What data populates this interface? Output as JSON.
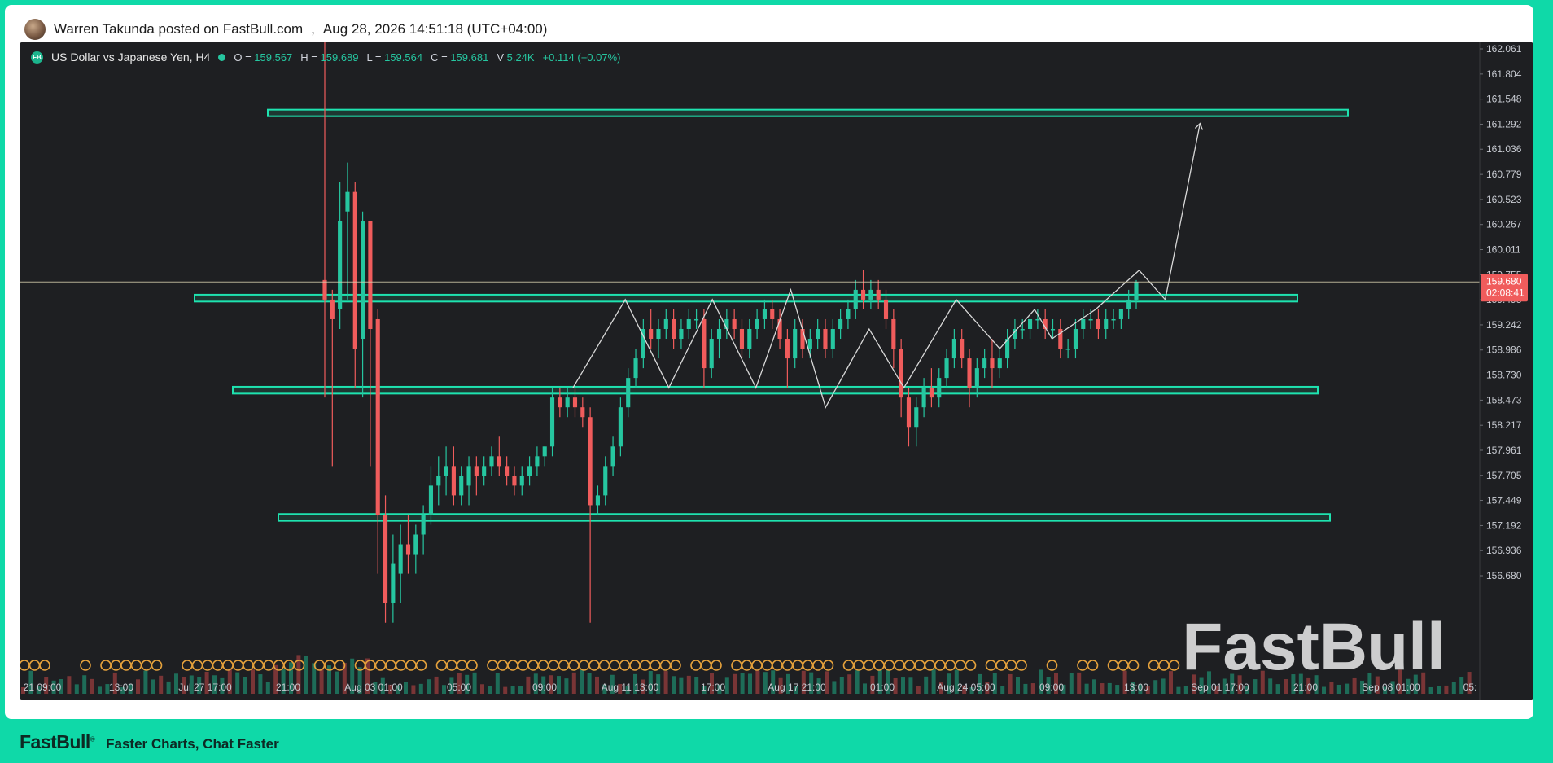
{
  "post": {
    "author_line": "Warren Takunda posted on FastBull.com",
    "separator": ",",
    "timestamp": "Aug 28, 2026 14:51:18 (UTC+04:00)"
  },
  "legend": {
    "badge": "FB",
    "pair": "US Dollar vs Japanese Yen, H4",
    "o_label": "O =",
    "o_value": "159.567",
    "h_label": "H =",
    "h_value": "159.689",
    "l_label": "L =",
    "l_value": "159.564",
    "c_label": "C =",
    "c_value": "159.681",
    "v_label": "V",
    "v_value": "5.24K",
    "change": "+0.114 (+0.07%)"
  },
  "watermark": "FastBull",
  "footer": {
    "brand": "FastBull",
    "tagline": "Faster Charts, Chat Faster"
  },
  "colors": {
    "background": "#1e1f22",
    "up": "#26c6a0",
    "down": "#f05c5c",
    "zone": "#1ee3b0",
    "brand_green": "#0fd9a8"
  },
  "chart_data": {
    "type": "candlestick",
    "title": "US Dollar vs Japanese Yen, H4",
    "y_axis": {
      "ticks": [
        "162.061",
        "161.804",
        "161.548",
        "161.292",
        "161.036",
        "160.779",
        "160.523",
        "160.267",
        "160.011",
        "159.755",
        "159.498",
        "159.242",
        "158.986",
        "158.730",
        "158.473",
        "158.217",
        "157.961",
        "157.705",
        "157.449",
        "157.192",
        "156.936",
        "156.680"
      ],
      "range": [
        156.5,
        162.1
      ]
    },
    "x_axis": {
      "ticks": [
        "21 09:00",
        "13:00",
        "Jul 27 17:00",
        "21:00",
        "Aug 03 01:00",
        "05:00",
        "09:00",
        "Aug 11 13:00",
        "17:00",
        "Aug 17 21:00",
        "01:00",
        "Aug 24 05:00",
        "09:00",
        "13:00",
        "Sep 01 17:00",
        "21:00",
        "Sep 08 01:00",
        "05:"
      ]
    },
    "current_price": {
      "value": "159.680",
      "countdown": "02:08:41"
    },
    "zones": [
      {
        "label": "resistance-top",
        "price_low": 161.38,
        "price_high": 161.44
      },
      {
        "label": "resistance-mid",
        "price_low": 159.48,
        "price_high": 159.55
      },
      {
        "label": "support-mid",
        "price_low": 158.54,
        "price_high": 158.61
      },
      {
        "label": "support-low",
        "price_low": 157.24,
        "price_high": 157.31
      }
    ],
    "ohlc": [
      [
        159.7,
        163.0,
        158.5,
        159.5
      ],
      [
        159.5,
        159.6,
        157.8,
        159.3
      ],
      [
        159.4,
        160.7,
        159.2,
        160.3
      ],
      [
        160.4,
        160.9,
        159.5,
        160.6
      ],
      [
        160.6,
        160.7,
        158.6,
        159.0
      ],
      [
        159.1,
        160.4,
        158.5,
        160.3
      ],
      [
        160.3,
        160.3,
        157.8,
        159.2
      ],
      [
        159.3,
        159.4,
        156.7,
        157.3
      ],
      [
        157.3,
        157.5,
        156.2,
        156.4
      ],
      [
        156.4,
        157.1,
        156.2,
        156.8
      ],
      [
        156.7,
        157.2,
        156.4,
        157.0
      ],
      [
        157.0,
        157.3,
        156.7,
        156.9
      ],
      [
        156.9,
        157.2,
        156.7,
        157.1
      ],
      [
        157.1,
        157.4,
        156.9,
        157.3
      ],
      [
        157.3,
        157.8,
        157.2,
        157.6
      ],
      [
        157.6,
        157.9,
        157.4,
        157.7
      ],
      [
        157.7,
        158.0,
        157.5,
        157.8
      ],
      [
        157.8,
        158.0,
        157.4,
        157.5
      ],
      [
        157.5,
        157.8,
        157.4,
        157.7
      ],
      [
        157.6,
        157.9,
        157.4,
        157.8
      ],
      [
        157.8,
        157.9,
        157.5,
        157.7
      ],
      [
        157.7,
        157.9,
        157.6,
        157.8
      ],
      [
        157.8,
        158.0,
        157.7,
        157.9
      ],
      [
        157.9,
        158.1,
        157.7,
        157.8
      ],
      [
        157.8,
        157.9,
        157.6,
        157.7
      ],
      [
        157.7,
        157.8,
        157.5,
        157.6
      ],
      [
        157.6,
        157.8,
        157.5,
        157.7
      ],
      [
        157.7,
        157.9,
        157.6,
        157.8
      ],
      [
        157.8,
        158.0,
        157.7,
        157.9
      ],
      [
        157.9,
        158.0,
        157.8,
        158.0
      ],
      [
        158.0,
        158.6,
        157.9,
        158.5
      ],
      [
        158.5,
        158.6,
        158.3,
        158.4
      ],
      [
        158.4,
        158.6,
        158.3,
        158.5
      ],
      [
        158.5,
        158.6,
        158.3,
        158.4
      ],
      [
        158.4,
        158.5,
        158.2,
        158.3
      ],
      [
        158.3,
        158.4,
        156.2,
        157.4
      ],
      [
        157.4,
        157.6,
        157.3,
        157.5
      ],
      [
        157.5,
        157.9,
        157.4,
        157.8
      ],
      [
        157.8,
        158.1,
        157.7,
        158.0
      ],
      [
        158.0,
        158.5,
        157.9,
        158.4
      ],
      [
        158.4,
        158.8,
        158.3,
        158.7
      ],
      [
        158.7,
        159.0,
        158.6,
        158.9
      ],
      [
        158.9,
        159.3,
        158.8,
        159.2
      ],
      [
        159.2,
        159.4,
        159.0,
        159.1
      ],
      [
        159.1,
        159.3,
        158.9,
        159.2
      ],
      [
        159.2,
        159.4,
        159.1,
        159.3
      ],
      [
        159.3,
        159.4,
        159.0,
        159.1
      ],
      [
        159.1,
        159.3,
        159.0,
        159.2
      ],
      [
        159.2,
        159.4,
        159.1,
        159.3
      ],
      [
        159.3,
        159.4,
        159.2,
        159.3
      ],
      [
        159.3,
        159.4,
        158.6,
        158.8
      ],
      [
        158.8,
        159.2,
        158.7,
        159.1
      ],
      [
        159.1,
        159.3,
        158.9,
        159.2
      ],
      [
        159.2,
        159.4,
        159.1,
        159.3
      ],
      [
        159.3,
        159.4,
        159.1,
        159.2
      ],
      [
        159.2,
        159.3,
        158.9,
        159.0
      ],
      [
        159.0,
        159.3,
        158.9,
        159.2
      ],
      [
        159.2,
        159.4,
        159.1,
        159.3
      ],
      [
        159.3,
        159.5,
        159.2,
        159.4
      ],
      [
        159.4,
        159.5,
        159.2,
        159.3
      ],
      [
        159.3,
        159.4,
        159.0,
        159.1
      ],
      [
        159.1,
        159.2,
        158.6,
        158.9
      ],
      [
        158.9,
        159.3,
        158.8,
        159.2
      ],
      [
        159.2,
        159.3,
        158.9,
        159.0
      ],
      [
        159.0,
        159.2,
        158.9,
        159.1
      ],
      [
        159.1,
        159.3,
        159.0,
        159.2
      ],
      [
        159.2,
        159.3,
        158.9,
        159.0
      ],
      [
        159.0,
        159.3,
        158.9,
        159.2
      ],
      [
        159.2,
        159.4,
        159.1,
        159.3
      ],
      [
        159.3,
        159.5,
        159.2,
        159.4
      ],
      [
        159.4,
        159.7,
        159.3,
        159.6
      ],
      [
        159.6,
        159.8,
        159.4,
        159.5
      ],
      [
        159.5,
        159.7,
        159.4,
        159.6
      ],
      [
        159.6,
        159.7,
        159.4,
        159.5
      ],
      [
        159.5,
        159.6,
        159.2,
        159.3
      ],
      [
        159.3,
        159.4,
        158.8,
        159.0
      ],
      [
        159.0,
        159.1,
        158.3,
        158.5
      ],
      [
        158.5,
        158.6,
        158.0,
        158.2
      ],
      [
        158.2,
        158.5,
        158.0,
        158.4
      ],
      [
        158.4,
        158.7,
        158.3,
        158.6
      ],
      [
        158.6,
        158.8,
        158.4,
        158.5
      ],
      [
        158.5,
        158.8,
        158.4,
        158.7
      ],
      [
        158.7,
        159.0,
        158.6,
        158.9
      ],
      [
        158.9,
        159.2,
        158.8,
        159.1
      ],
      [
        159.1,
        159.2,
        158.8,
        158.9
      ],
      [
        158.9,
        159.0,
        158.4,
        158.6
      ],
      [
        158.6,
        158.9,
        158.5,
        158.8
      ],
      [
        158.8,
        159.0,
        158.7,
        158.9
      ],
      [
        158.9,
        159.1,
        158.6,
        158.8
      ],
      [
        158.8,
        159.0,
        158.7,
        158.9
      ],
      [
        158.9,
        159.2,
        158.8,
        159.1
      ],
      [
        159.1,
        159.3,
        159.0,
        159.2
      ],
      [
        159.2,
        159.3,
        159.1,
        159.2
      ],
      [
        159.2,
        159.3,
        159.1,
        159.3
      ],
      [
        159.3,
        159.4,
        159.2,
        159.3
      ],
      [
        159.3,
        159.4,
        159.1,
        159.2
      ],
      [
        159.2,
        159.3,
        159.1,
        159.2
      ],
      [
        159.2,
        159.3,
        158.9,
        159.0
      ],
      [
        159.0,
        159.1,
        158.9,
        159.0
      ],
      [
        159.0,
        159.3,
        158.9,
        159.2
      ],
      [
        159.2,
        159.4,
        159.1,
        159.3
      ],
      [
        159.3,
        159.4,
        159.2,
        159.3
      ],
      [
        159.3,
        159.4,
        159.1,
        159.2
      ],
      [
        159.2,
        159.4,
        159.1,
        159.3
      ],
      [
        159.3,
        159.4,
        159.2,
        159.3
      ],
      [
        159.3,
        159.4,
        159.2,
        159.4
      ],
      [
        159.4,
        159.6,
        159.3,
        159.5
      ],
      [
        159.5,
        159.7,
        159.4,
        159.68
      ]
    ],
    "projection_path": [
      [
        0,
        158.6
      ],
      [
        6,
        159.5
      ],
      [
        11,
        158.6
      ],
      [
        16,
        159.5
      ],
      [
        21,
        158.6
      ],
      [
        25,
        159.6
      ],
      [
        29,
        158.4
      ],
      [
        34,
        159.2
      ],
      [
        38,
        158.6
      ],
      [
        44,
        159.5
      ],
      [
        49,
        159.0
      ],
      [
        53,
        159.4
      ],
      [
        55,
        159.1
      ],
      [
        60,
        159.4
      ],
      [
        65,
        159.8
      ],
      [
        68,
        159.5
      ],
      [
        72,
        161.3
      ]
    ]
  }
}
